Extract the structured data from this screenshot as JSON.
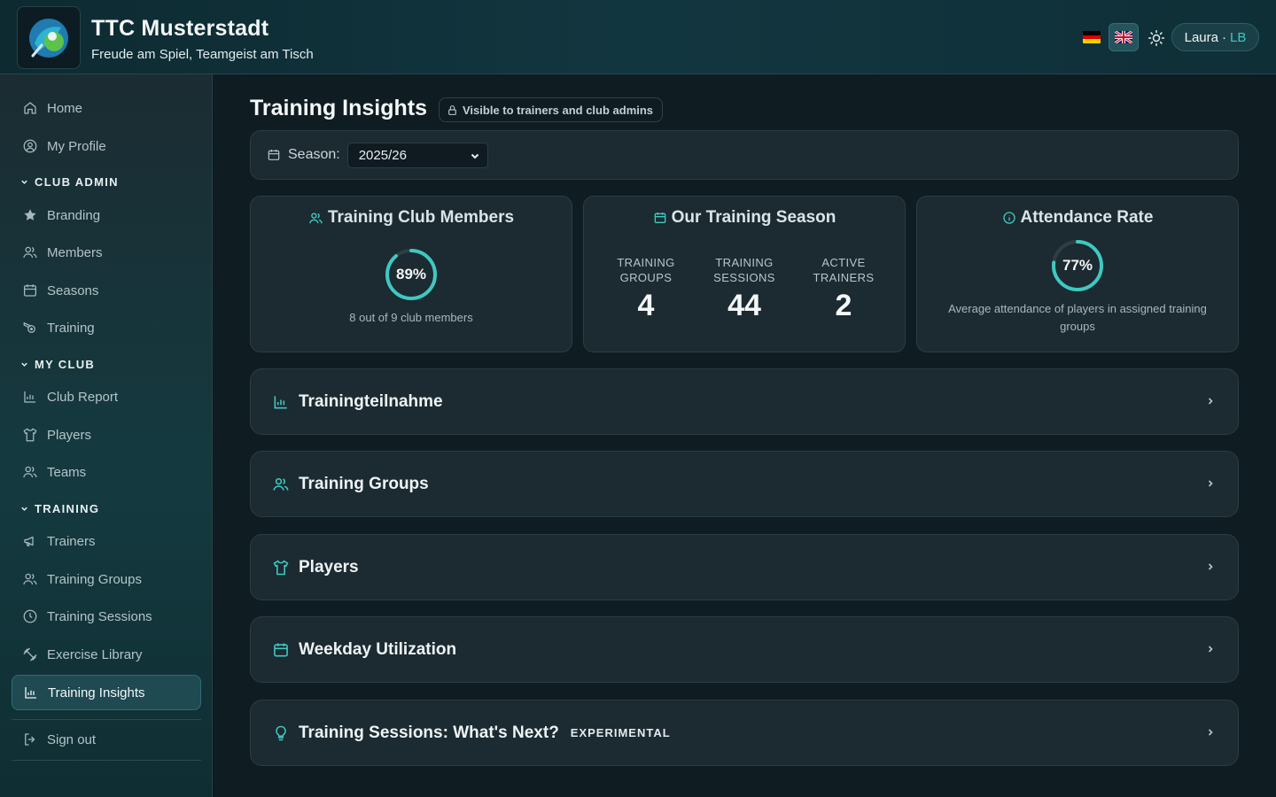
{
  "header": {
    "club_name": "TTC Musterstadt",
    "tagline": "Freude am Spiel, Teamgeist am Tisch",
    "user_name": "Laura",
    "user_sep": "·",
    "user_initials": "LB",
    "languages": [
      "de",
      "en"
    ],
    "active_language": "en"
  },
  "sidebar": {
    "home": "Home",
    "my_profile": "My Profile",
    "section_club_admin": "CLUB ADMIN",
    "branding": "Branding",
    "members": "Members",
    "seasons": "Seasons",
    "training": "Training",
    "section_my_club": "MY CLUB",
    "club_report": "Club Report",
    "players": "Players",
    "teams": "Teams",
    "section_training": "TRAINING",
    "trainers": "Trainers",
    "training_groups": "Training Groups",
    "training_sessions": "Training Sessions",
    "exercise_library": "Exercise Library",
    "training_insights": "Training Insights",
    "sign_out": "Sign out"
  },
  "main": {
    "title": "Training Insights",
    "visibility_badge": "Visible to trainers and club admins",
    "season_label": "Season:",
    "season_value": "2025/26",
    "cards": {
      "members": {
        "title": "Training Club Members",
        "percent": 89,
        "percent_label": "89%",
        "subtitle": "8 out of 9 club members"
      },
      "season": {
        "title": "Our Training Season",
        "groups_label": "Training Groups",
        "groups_value": "4",
        "sessions_label": "Training Sessions",
        "sessions_value": "44",
        "trainers_label": "Active Trainers",
        "trainers_value": "2"
      },
      "attendance": {
        "title": "Attendance Rate",
        "percent": 77,
        "percent_label": "77%",
        "subtitle": "Average attendance of players in assigned training groups"
      }
    },
    "sections": {
      "participation": "Trainingteilnahme",
      "groups": "Training Groups",
      "players": "Players",
      "weekday": "Weekday Utilization",
      "whats_next": "Training Sessions: What's Next?",
      "whats_next_tag": "EXPERIMENTAL"
    }
  },
  "colors": {
    "accent": "#3ec9c1",
    "ring_track": "#2e3e44"
  }
}
